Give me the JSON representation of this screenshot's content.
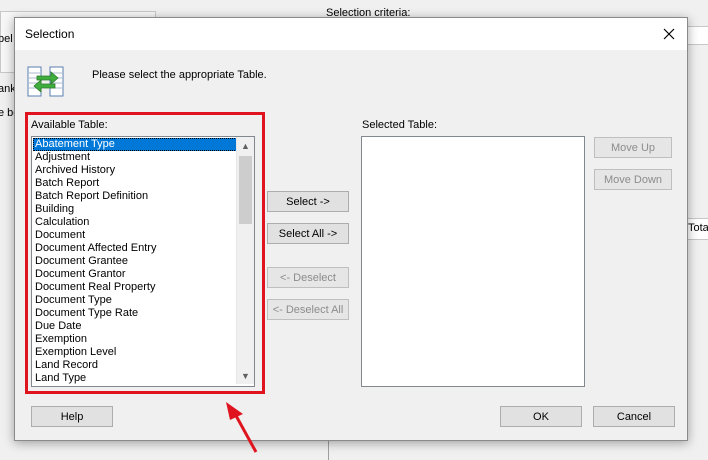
{
  "background": {
    "criteria_label": "Selection criteria:",
    "fragments": [
      "bel",
      "ank",
      "e be",
      "Tota"
    ]
  },
  "dialog": {
    "title": "Selection",
    "instruction": "Please select the appropriate Table.",
    "available_label": "Available Table:",
    "selected_label": "Selected Table:",
    "available_items": [
      "Abatement Type",
      "Adjustment",
      "Archived History",
      "Batch Report",
      "Batch Report Definition",
      "Building",
      "Calculation",
      "Document",
      "Document Affected Entry",
      "Document Grantee",
      "Document Grantor",
      "Document Real Property",
      "Document Type",
      "Document Type Rate",
      "Due Date",
      "Exemption",
      "Exemption Level",
      "Land Record",
      "Land Type"
    ],
    "selected_item": "Abatement Type",
    "selected_items": [],
    "buttons": {
      "select": "Select ->",
      "select_all": "Select All ->",
      "deselect": "<- Deselect",
      "deselect_all": "<- Deselect All",
      "move_up": "Move Up",
      "move_down": "Move Down",
      "help": "Help",
      "ok": "OK",
      "cancel": "Cancel"
    }
  },
  "annotation_color": "#e0141e"
}
